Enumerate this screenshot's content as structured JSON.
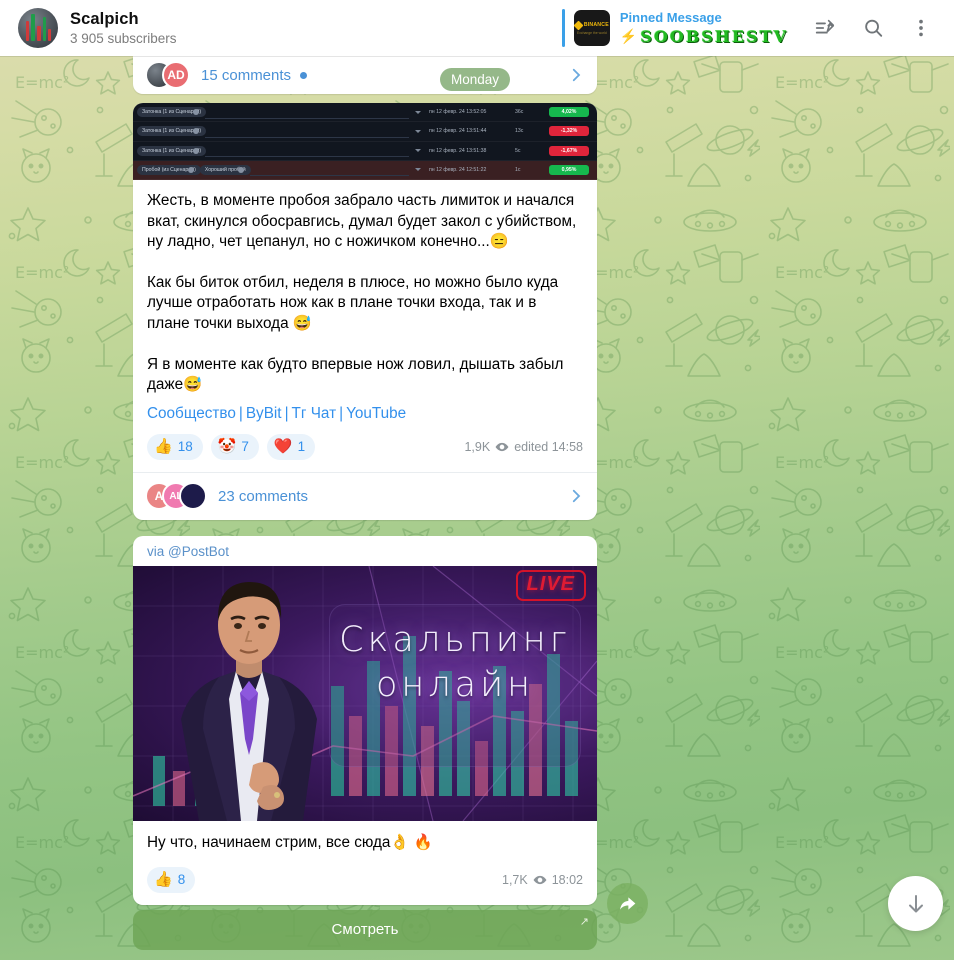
{
  "header": {
    "channel_name": "Scalpich",
    "subscribers": "3 905 subscribers",
    "pinned_label": "Pinned Message",
    "pinned_text": "SOOBSHESTV",
    "pinned_bolt": "⚡",
    "pinned_thumb_brand": "BINANCE",
    "pinned_thumb_tagline": "Exchange the world",
    "icons": {
      "pinned_list": "pinned-list-icon",
      "search": "search-icon",
      "menu": "more-vertical-icon"
    }
  },
  "date_separator": "Monday",
  "top_message": {
    "comments_label": "15 comments",
    "avatars": [
      {
        "initials": "",
        "color": "#4a5058"
      },
      {
        "initials": "AD",
        "color": "#e96d72"
      }
    ]
  },
  "post1": {
    "trade_rows": [
      {
        "tags": [
          "Затонка (1 из Сценарий)"
        ],
        "date": "пн 12 февр. 24 13:52:05",
        "duration": "36с",
        "pct": "4,02%",
        "dir": "up",
        "highlight": false
      },
      {
        "tags": [
          "Затонка (1 из Сценарий)"
        ],
        "date": "пн 12 февр. 24 13:51:44",
        "duration": "13с",
        "pct": "-1,32%",
        "dir": "down",
        "highlight": false
      },
      {
        "tags": [
          "Затонка (1 из Сценарий)"
        ],
        "date": "пн 12 февр. 24 13:51:38",
        "duration": "5с",
        "pct": "-1,67%",
        "dir": "down",
        "highlight": false
      },
      {
        "tags": [
          "Пробой (из Сценарий)",
          "Хороший пробой"
        ],
        "date": "пн 12 февр. 24 12:51:22",
        "duration": "1с",
        "pct": "0,95%",
        "dir": "up",
        "highlight": true
      }
    ],
    "paragraphs": [
      "Жесть, в моменте пробоя забрало часть лимиток и начался вкат, скинулся обосравгись, думал будет закол с убийством, ну ладно, чет цепанул, но с ножичком конечно...😑",
      "Как бы биток отбил, неделя в плюсе, но можно было куда лучше отработать нож как в плане точки входа, так и в плане точки выхода 😅",
      "Я в моменте как будто впервые нож ловил, дышать забыл даже😅"
    ],
    "links": [
      "Сообщество",
      "ByBit",
      "Тг Чат",
      "YouTube"
    ],
    "link_separator": "|",
    "reactions": [
      {
        "emoji": "👍",
        "count": "18"
      },
      {
        "emoji": "🤡",
        "count": "7"
      },
      {
        "emoji": "❤️",
        "count": "1"
      }
    ],
    "views": "1,9K",
    "edited": "edited 14:58",
    "comments_label": "23 comments",
    "comment_avatars": [
      {
        "initials": "A",
        "color": "#ea8585"
      },
      {
        "initials": "AL",
        "color": "#f07ab0"
      },
      {
        "initials": "",
        "color": "#1d1b4a"
      }
    ]
  },
  "post2": {
    "via": "via @PostBot",
    "live_badge": "LIVE",
    "banner_title_line1": "Скальпинг",
    "banner_title_line2": "онлайн",
    "caption": "Ну что, начинаем стрим, все сюда👌 🔥",
    "reactions": [
      {
        "emoji": "👍",
        "count": "8"
      }
    ],
    "views": "1,7K",
    "time": "18:02",
    "watch_button": "Смотреть"
  },
  "fabs": {
    "share": "share-icon",
    "scroll_down": "arrow-down-icon"
  },
  "colors": {
    "accent_blue": "#3390ec",
    "green_up": "#16b84e",
    "red_down": "#e0253b",
    "pinned_green": "#22b922",
    "wallpaper_top": "#ddddb0",
    "wallpaper_bottom": "#8cc07f"
  }
}
